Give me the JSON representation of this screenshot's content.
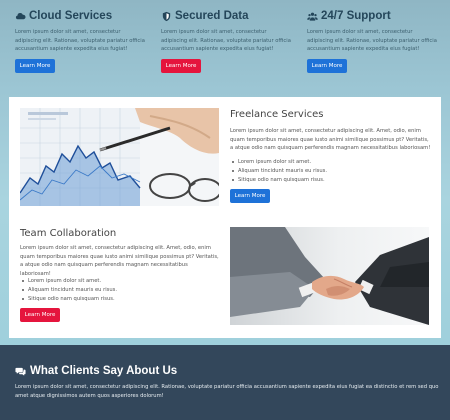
{
  "features": [
    {
      "title": "Cloud Services",
      "icon": "cloud-icon",
      "description": "Lorem ipsum dolor sit amet, consectetur adipiscing elit. Rationae, voluptate pariatur officia accusantium sapiente expedita eius fugiat!",
      "button": "Learn More",
      "button_color": "#1e72d8"
    },
    {
      "title": "Secured Data",
      "icon": "shield-icon",
      "description": "Lorem ipsum dolor sit amet, consectetur adipiscing elit. Rationae, voluptate pariatur officia accusantium sapiente expedita eius fugiat!",
      "button": "Learn More",
      "button_color": "#e5153d"
    },
    {
      "title": "24/7 Support",
      "icon": "users-icon",
      "description": "Lorem ipsum dolor sit amet, consectetur adipiscing elit. Rationae, voluptate pariatur officia accusantium sapiente expedita eius fugiat!",
      "button": "Learn More",
      "button_color": "#1e72d8"
    }
  ],
  "freelance": {
    "title": "Freelance Services",
    "text": "Lorem ipsum dolor sit amet, consectetur adipiscing elit. Amet, odio, enim quam temporibus maiores quae iusto animi similique possimus pt? Veritatis, a atque odio nam quisquam perferendis magnam necessitatibus laboriosam!",
    "bullets": [
      "Lorem ipsum dolor sit amet.",
      "Aliquam tincidunt mauris eu risus.",
      "Sitique odio nam quisquam risus."
    ],
    "button": "Learn More",
    "image": "business-chart-image"
  },
  "team": {
    "title": "Team Collaboration",
    "text": "Lorem ipsum dolor sit amet, consectetur adipiscing elit. Amet, odio, enim quam temporibus maiores quae iusto animi similique possimus pt? Veritatis, a atque odio nam quisquam perferendis magnam necessitatibus laboriosam!",
    "bullets": [
      "Lorem ipsum dolor sit amet.",
      "Aliquam tincidunt mauris eu risus.",
      "Sitique odio nam quisquam risus."
    ],
    "button": "Learn More",
    "image": "handshake-image"
  },
  "clients": {
    "title": "What Clients Say About Us",
    "icon": "comments-icon",
    "text": "Lorem ipsum dolor sit amet, consectetur adipiscing elit. Rationae, voluptate pariatur officia accusantium sapiente expedita eius fugiat ea distinctio et rem sed quo amet atque dignissimos autem quos asperiores dolorum!"
  },
  "colors": {
    "title": "#24465a",
    "blue_button": "#1e72d8",
    "red_button": "#e5153d",
    "footer_bg": "#33475b"
  }
}
